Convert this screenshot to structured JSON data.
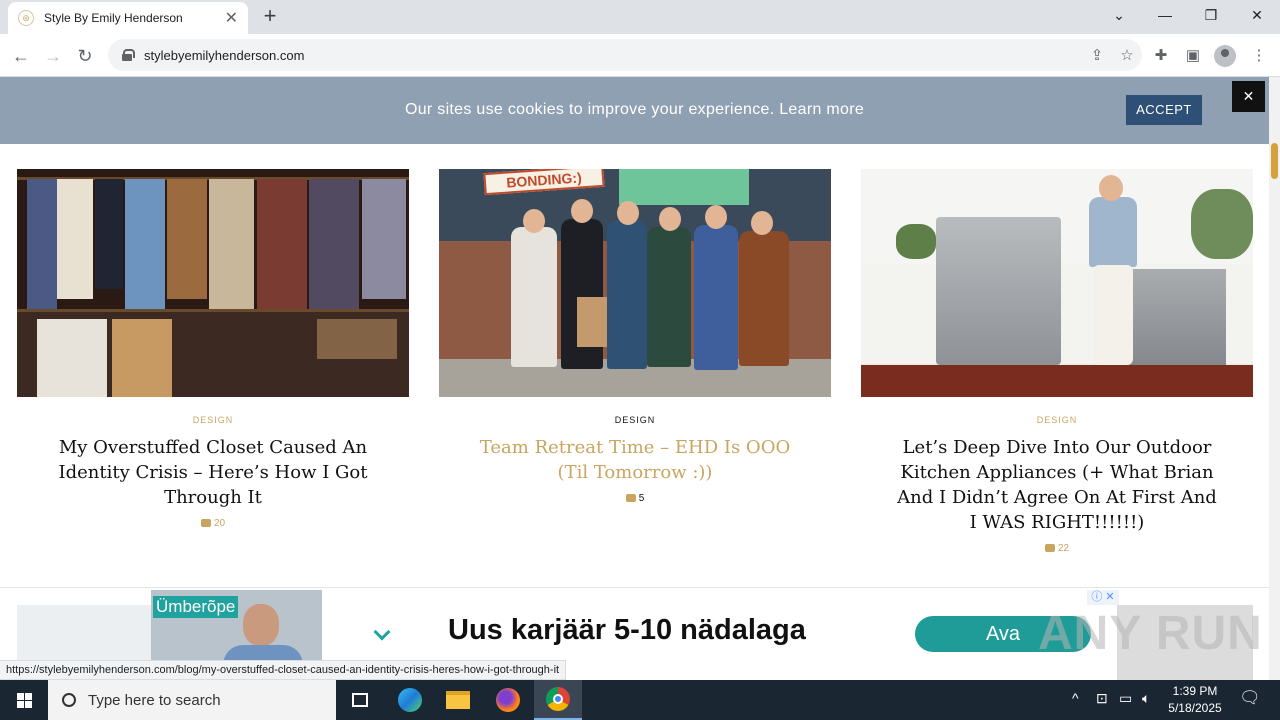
{
  "browser": {
    "tab_title": "Style By Emily Henderson",
    "new_tab": "+",
    "tab_close": "✕",
    "url": "stylebyemilyhenderson.com",
    "status_url": "https://stylebyemilyhenderson.com/blog/my-overstuffed-closet-caused-an-identity-crisis-heres-how-i-got-through-it"
  },
  "cookie_banner": {
    "message": "Our sites use cookies to improve your experience. Learn more",
    "accept_label": "ACCEPT",
    "close_label": "✕"
  },
  "posts": [
    {
      "category": "DESIGN",
      "title": "My Overstuffed Closet Caused An Identity Crisis – Here’s How I Got Through It",
      "comments": "20"
    },
    {
      "category": "DESIGN",
      "title": "Team Retreat Time – EHD Is OOO (Til Tomorrow :))",
      "comments": "5",
      "sign_text": "BONDING:)"
    },
    {
      "category": "DESIGN",
      "title": "Let’s Deep Dive Into Our Outdoor Kitchen Appliances (+ What Brian And I Didn’t Agree On At First And I WAS RIGHT!!!!!!)",
      "comments": "22"
    }
  ],
  "ad": {
    "brand": "Ümberõpe",
    "headline": "Uus karjäär 5-10 nädalaga",
    "cta": "Ava",
    "info_label": "ⓘ ✕"
  },
  "watermark": "ANY RUN",
  "taskbar": {
    "search_placeholder": "Type here to search",
    "time": "1:39 PM",
    "date": "5/18/2025"
  },
  "colors": {
    "accent_gold": "#c9a55f",
    "cookie_bg": "#8fa0b3",
    "accept_bg": "#2f5076",
    "ad_teal": "#1f9c98"
  }
}
